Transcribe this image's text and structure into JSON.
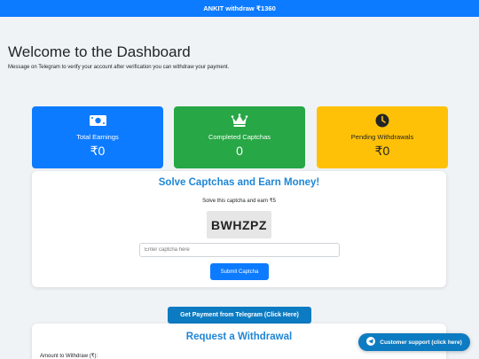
{
  "banner": {
    "text": "ANKIT withdraw ₹1360"
  },
  "header": {
    "title": "Welcome to the Dashboard",
    "subtitle": "Message on Telegram to verify your account after verification you can withdraw your payment."
  },
  "stats": [
    {
      "label": "Total Earnings",
      "value": "₹0",
      "icon": "money-icon",
      "color": "#0d7bff"
    },
    {
      "label": "Completed Captchas",
      "value": "0",
      "icon": "crown-icon",
      "color": "#27a745"
    },
    {
      "label": "Pending Withdrawals",
      "value": "₹0",
      "icon": "clock-icon",
      "color": "#ffc107"
    }
  ],
  "captcha": {
    "title": "Solve Captchas and Earn Money!",
    "instruction": "Solve this captcha and earn ₹5",
    "code": "BWHZPZ",
    "input_placeholder": "Enter captcha here",
    "submit_label": "Submit Captcha"
  },
  "telegram_button": "Get Payment from Telegram (Click Here)",
  "withdrawal": {
    "title": "Request a Withdrawal",
    "amount_label": "Amount to Withdraw (₹):"
  },
  "support_button": {
    "label": "Customer support (click here)",
    "icon": "telegram-icon"
  },
  "colors": {
    "primary": "#0d7bff",
    "success": "#27a745",
    "warning": "#ffc107",
    "heading": "#1f86d6"
  }
}
